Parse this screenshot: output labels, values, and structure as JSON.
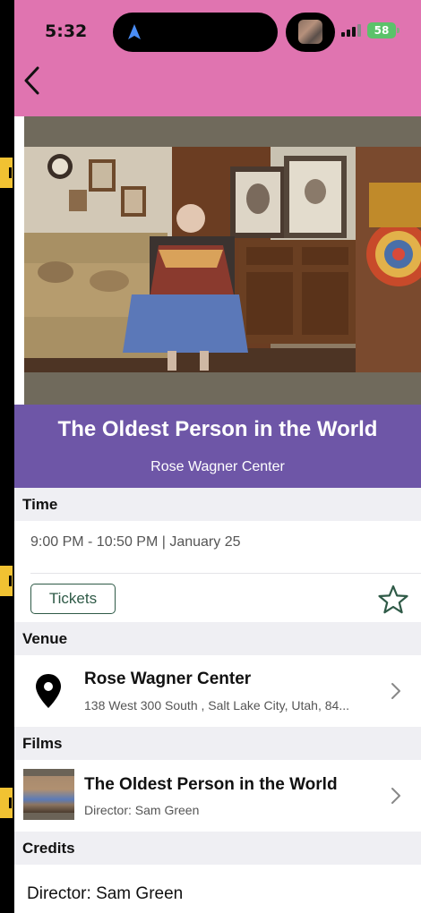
{
  "status_bar": {
    "time": "5:32",
    "battery": "58"
  },
  "event": {
    "title": "The Oldest Person in the World",
    "venue_name": "Rose Wagner Center"
  },
  "sections": {
    "time_label": "Time",
    "venue_label": "Venue",
    "films_label": "Films",
    "credits_label": "Credits"
  },
  "time_info": {
    "text": "9:00 PM - 10:50 PM | January 25"
  },
  "actions": {
    "tickets_label": "Tickets"
  },
  "venue": {
    "name": "Rose Wagner Center",
    "address": "138 West 300 South , Salt Lake City, Utah, 84..."
  },
  "film": {
    "title": "The Oldest Person in the World",
    "director": "Director: Sam Green"
  },
  "credits": {
    "director": "Director: Sam Green"
  },
  "colors": {
    "header_pink": "#e074b0",
    "title_purple": "#6e56a7",
    "accent_green": "#2f5a47",
    "section_gray": "#efeff3"
  },
  "icons": {
    "back": "chevron-left-icon",
    "location": "map-pin-icon",
    "favorite": "star-outline-icon",
    "row_nav": "chevron-right-icon"
  }
}
